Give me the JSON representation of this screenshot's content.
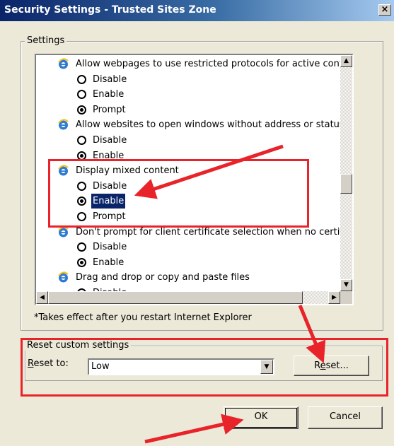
{
  "window": {
    "title": "Security Settings - Trusted Sites Zone",
    "close_glyph": "×"
  },
  "settings": {
    "legend": "Settings",
    "items": [
      {
        "type": "header",
        "label": "Allow webpages to use restricted protocols for active conten",
        "icon": "ie-icon"
      },
      {
        "type": "option",
        "label": "Disable",
        "checked": false
      },
      {
        "type": "option",
        "label": "Enable",
        "checked": false
      },
      {
        "type": "option",
        "label": "Prompt",
        "checked": true
      },
      {
        "type": "header",
        "label": "Allow websites to open windows without address or status ba",
        "icon": "ie-icon"
      },
      {
        "type": "option",
        "label": "Disable",
        "checked": false
      },
      {
        "type": "option",
        "label": "Enable",
        "checked": true
      },
      {
        "type": "header",
        "label": "Display mixed content",
        "icon": "ie-icon"
      },
      {
        "type": "option",
        "label": "Disable",
        "checked": false
      },
      {
        "type": "option",
        "label": "Enable",
        "checked": true,
        "selected": true
      },
      {
        "type": "option",
        "label": "Prompt",
        "checked": false
      },
      {
        "type": "header",
        "label": "Don't prompt for client certificate selection when no certificat",
        "icon": "ie-icon"
      },
      {
        "type": "option",
        "label": "Disable",
        "checked": false
      },
      {
        "type": "option",
        "label": "Enable",
        "checked": true
      },
      {
        "type": "header",
        "label": "Drag and drop or copy and paste files",
        "icon": "ie-icon"
      },
      {
        "type": "option",
        "label": "Disable",
        "checked": false
      }
    ],
    "note": "*Takes effect after you restart Internet Explorer"
  },
  "reset": {
    "legend": "Reset custom settings",
    "reset_to_label": "Reset to:",
    "selected_value": "Low",
    "reset_button": "Reset..."
  },
  "buttons": {
    "ok": "OK",
    "cancel": "Cancel"
  },
  "colors": {
    "annotation_red": "#e8232a",
    "title_blue": "#0a246a",
    "selection_blue": "#0a246a"
  }
}
